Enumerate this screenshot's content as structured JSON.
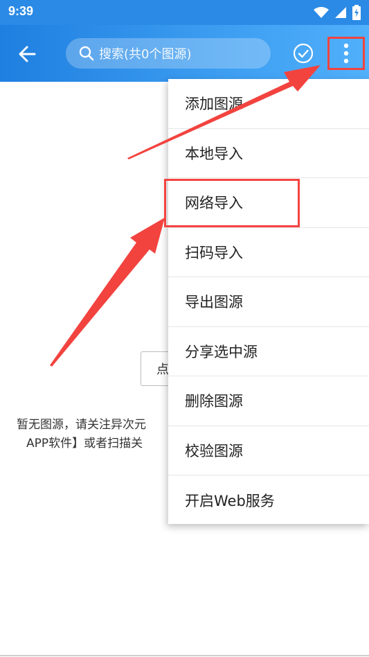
{
  "status_bar": {
    "time": "9:39"
  },
  "app_bar": {
    "search_placeholder": "搜索(共0个图源)"
  },
  "menu": {
    "items": [
      {
        "label": "添加图源"
      },
      {
        "label": "本地导入"
      },
      {
        "label": "网络导入"
      },
      {
        "label": "扫码导入"
      },
      {
        "label": "导出图源"
      },
      {
        "label": "分享选中源"
      },
      {
        "label": "删除图源"
      },
      {
        "label": "校验图源"
      },
      {
        "label": "开启Web服务"
      }
    ]
  },
  "empty_state": {
    "button_partial": "点",
    "line1": "暂无图源，请关注异次元",
    "line2": "APP软件】或者扫描关"
  },
  "colors": {
    "accent": "#2a8ae6",
    "annotation": "#f2433f"
  },
  "icons": [
    "back-arrow-icon",
    "search-icon",
    "check-circle-icon",
    "more-vert-icon",
    "wifi-icon",
    "signal-icon",
    "battery-icon"
  ]
}
